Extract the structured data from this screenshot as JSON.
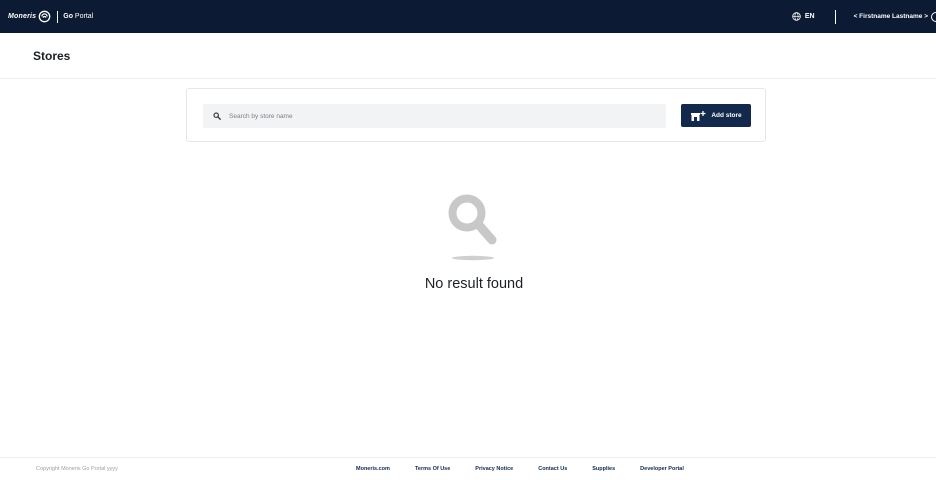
{
  "topbar": {
    "brand_name": "Moneris",
    "portal_name_bold": "Go",
    "portal_name_rest": " Portal",
    "language": "EN",
    "user_menu": "< Firstname Lastname >"
  },
  "page": {
    "title": "Stores"
  },
  "search": {
    "placeholder": "Search by store name",
    "value": "",
    "add_store_label": "Add store"
  },
  "empty_state": {
    "message": "No result found"
  },
  "footer": {
    "copyright": "Copyright Moneris Go Portal yyyy",
    "links": [
      "Moneris.com",
      "Terms Of Use",
      "Privacy Notice",
      "Contact Us",
      "Supplies",
      "Developer Portal"
    ]
  },
  "colors": {
    "topbar_bg": "#0c1a33",
    "primary_button": "#13294b",
    "search_bg": "#f2f3f5",
    "empty_icon": "#c8c8c8"
  },
  "icons": [
    "moneris-logo-icon",
    "globe-icon",
    "search-icon",
    "add-store-icon",
    "magnifier-empty-icon"
  ]
}
